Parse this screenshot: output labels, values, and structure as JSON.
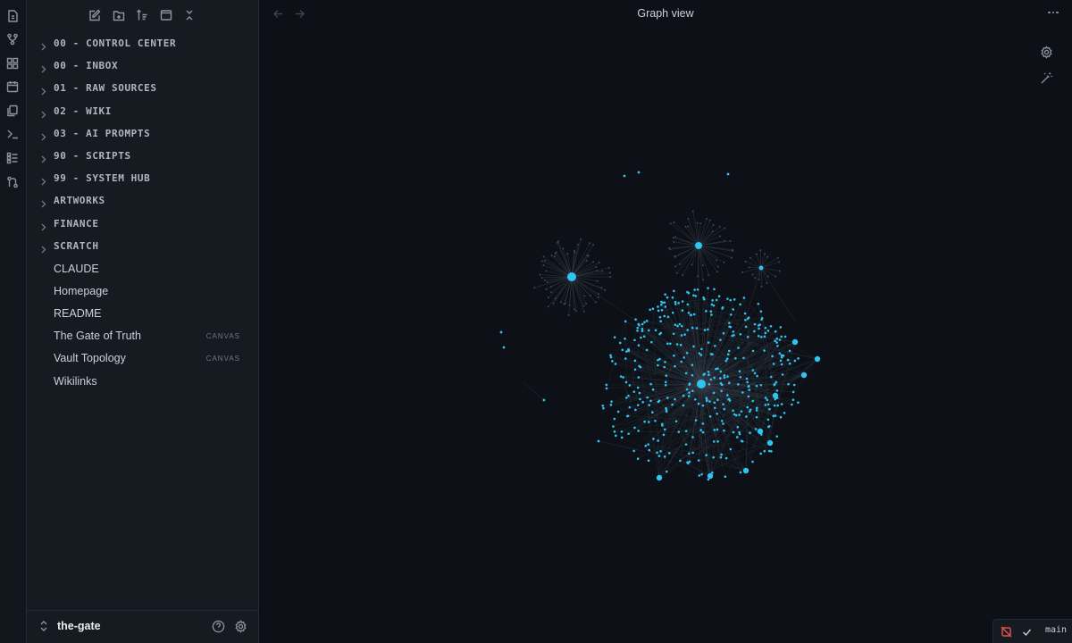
{
  "ribbon": {
    "icons": [
      "files-icon",
      "git-graph-icon",
      "blocks-icon",
      "calendar-icon",
      "copy-icon",
      "terminal-icon",
      "checklist-icon",
      "git-compare-icon"
    ]
  },
  "sidebar": {
    "toolbar": [
      "new-note-icon",
      "new-folder-icon",
      "sort-icon",
      "collapse-panel-icon",
      "collapse-all-icon"
    ],
    "folders": [
      {
        "label": "00 - CONTROL CENTER"
      },
      {
        "label": "00 - INBOX"
      },
      {
        "label": "01 - RAW SOURCES"
      },
      {
        "label": "02 - WIKI"
      },
      {
        "label": "03 - AI PROMPTS"
      },
      {
        "label": "90 - SCRIPTS"
      },
      {
        "label": "99 - SYSTEM HUB"
      },
      {
        "label": "ARTWORKS"
      },
      {
        "label": "FINANCE"
      },
      {
        "label": "SCRATCH"
      }
    ],
    "files": [
      {
        "label": "CLAUDE",
        "badge": ""
      },
      {
        "label": "Homepage",
        "badge": ""
      },
      {
        "label": "README",
        "badge": ""
      },
      {
        "label": "The Gate of Truth",
        "badge": "CANVAS"
      },
      {
        "label": "Vault Topology",
        "badge": "CANVAS"
      },
      {
        "label": "Wikilinks",
        "badge": ""
      }
    ],
    "vault_name": "the-gate"
  },
  "main": {
    "title": "Graph view"
  },
  "status": {
    "branch": "main"
  },
  "colors": {
    "node": "#2ec5f0",
    "node_dim": "#3a4a5a",
    "edge": "#3a4350",
    "accent_warn": "#e5534b"
  }
}
